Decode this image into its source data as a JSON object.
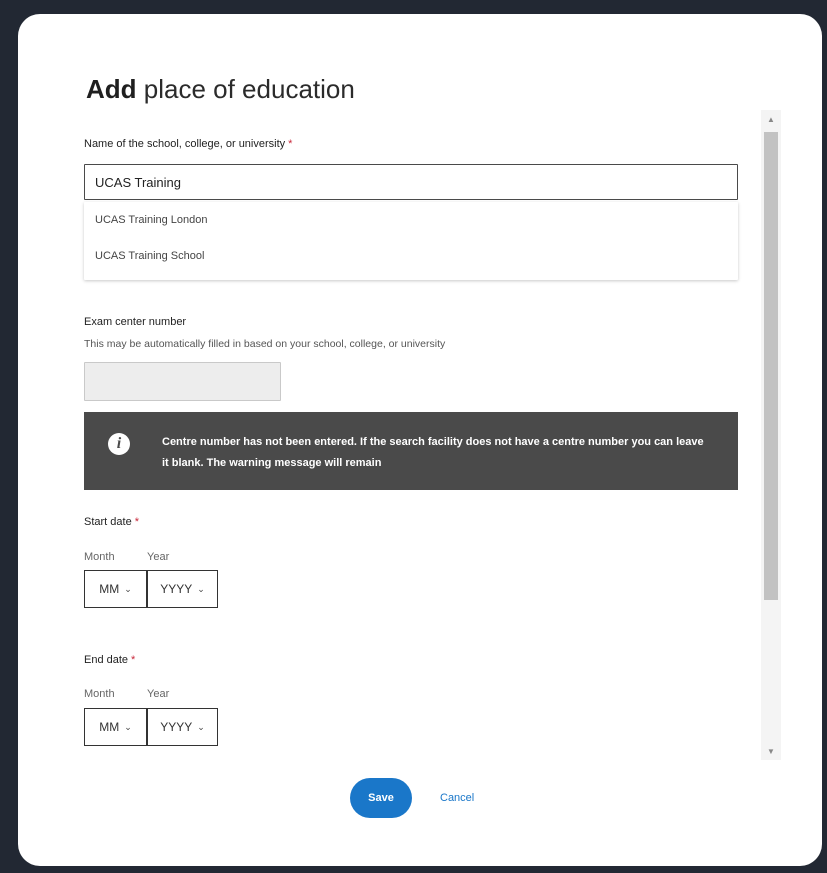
{
  "modal": {
    "title_bold": "Add",
    "title_rest": " place of education"
  },
  "school": {
    "label": "Name of the school, college, or university",
    "required_mark": "*",
    "value": "UCAS Training",
    "suggestions": [
      "UCAS Training London",
      "UCAS Training School"
    ]
  },
  "exam_centre": {
    "label": "Exam center number",
    "hint": "This may be automatically filled in based on your school, college, or university",
    "value": ""
  },
  "warning": {
    "icon": "info-icon",
    "icon_glyph": "i",
    "text": "Centre number has not been entered. If the search facility does not have a centre number you can leave it blank. The warning message will remain"
  },
  "start_date": {
    "label": "Start date",
    "required_mark": "*",
    "month_label": "Month",
    "year_label": "Year",
    "month_value": "MM",
    "year_value": "YYYY"
  },
  "end_date": {
    "label": "End date",
    "required_mark": "*",
    "month_label": "Month",
    "year_label": "Year",
    "month_value": "MM",
    "year_value": "YYYY"
  },
  "actions": {
    "save_label": "Save",
    "cancel_label": "Cancel"
  },
  "colors": {
    "accent": "#1a77c9",
    "required": "#c8283a",
    "warning_bg": "#4a4a4a",
    "backdrop": "#222833"
  }
}
